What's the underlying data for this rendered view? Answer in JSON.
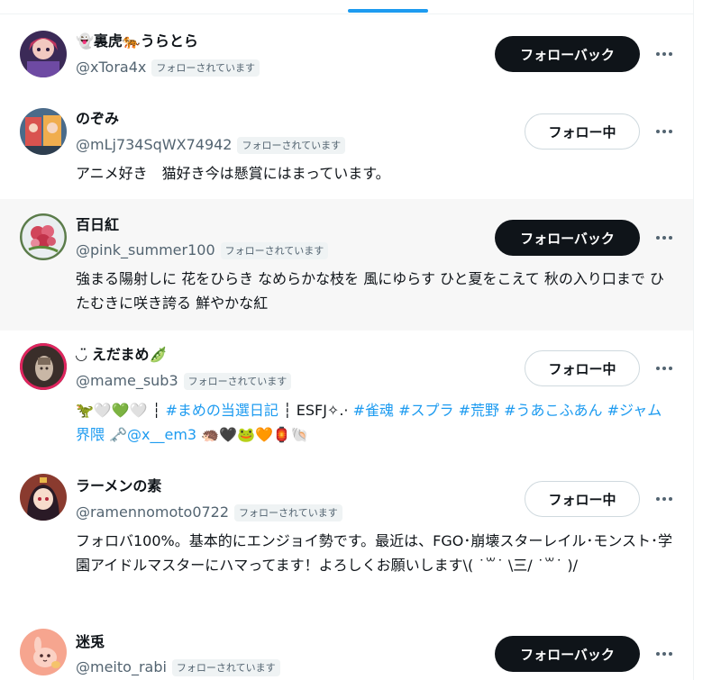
{
  "accounts": [
    {
      "name": "👻裏虎🐅うらとら",
      "handle": "@xTora4x",
      "badge": "フォローされています",
      "button": "フォローバック",
      "button_style": "followback",
      "bio": "",
      "avatar_icon": "anime-character-avatar"
    },
    {
      "name": "のぞみ",
      "handle": "@mLj734SqWX74942",
      "badge": "フォローされています",
      "button": "フォロー中",
      "button_style": "following",
      "bio": "アニメ好き　猫好き今は懸賞にはまっています。",
      "avatar_icon": "anime-poster-avatar"
    },
    {
      "name": "百日紅",
      "handle": "@pink_summer100",
      "badge": "フォローされています",
      "button": "フォローバック",
      "button_style": "followback",
      "bio": "強まる陽射しに 花をひらき なめらかな枝を 風にゆらす ひと夏をこえて 秋の入り口まで ひたむきに咲き誇る 鮮やかな紅",
      "avatar_icon": "red-flower-avatar"
    },
    {
      "name": "◡̈ えだまめ🫛",
      "handle": "@mame_sub3",
      "badge": "フォローされています",
      "button": "フォロー中",
      "button_style": "following",
      "bio_parts": [
        {
          "text": "🦖🤍💚🤍 ┆ ",
          "tag": false
        },
        {
          "text": "#まめの当選日記",
          "tag": true
        },
        {
          "text": " ┆  ESFJ✧.· ",
          "tag": false
        },
        {
          "text": "#雀魂",
          "tag": true
        },
        {
          "text": " ",
          "tag": false
        },
        {
          "text": "#スプラ",
          "tag": true
        },
        {
          "text": " ",
          "tag": false
        },
        {
          "text": "#荒野",
          "tag": true
        },
        {
          "text": " ",
          "tag": false
        },
        {
          "text": "#うあこふあん",
          "tag": true
        },
        {
          "text": " ",
          "tag": false
        },
        {
          "text": "#ジャム界隈",
          "tag": true
        },
        {
          "text": " 🗝️",
          "tag": false
        },
        {
          "text": "@x__em3",
          "tag": true
        },
        {
          "text": " 🦔🖤🐸🧡🏮🐚",
          "tag": false
        }
      ],
      "avatar_icon": "photo-avatar"
    },
    {
      "name": "ラーメンの素",
      "handle": "@ramennomoto0722",
      "badge": "フォローされています",
      "button": "フォロー中",
      "button_style": "following",
      "bio": "フォロバ100%。基本的にエンジョイ勢です。最近は、FGO･崩壊スターレイル･モンスト･学園アイドルマスターにハマってます！よろしくお願いします\\( ˙꒳​˙ \\三/ ˙꒳​˙ )/",
      "avatar_icon": "anime-girl-avatar"
    },
    {
      "name": "迷兎",
      "handle": "@meito_rabi",
      "badge": "フォローされています",
      "button": "フォローバック",
      "button_style": "followback",
      "bio": "",
      "avatar_icon": "pink-rabbit-avatar"
    }
  ],
  "colors": {
    "accent": "#1d9bf0",
    "text": "#0f1419",
    "secondary": "#536471",
    "followback_bg": "#0f1419",
    "highlight_row": "#f7f7f7"
  },
  "icons": {
    "more": "more-options-icon"
  }
}
